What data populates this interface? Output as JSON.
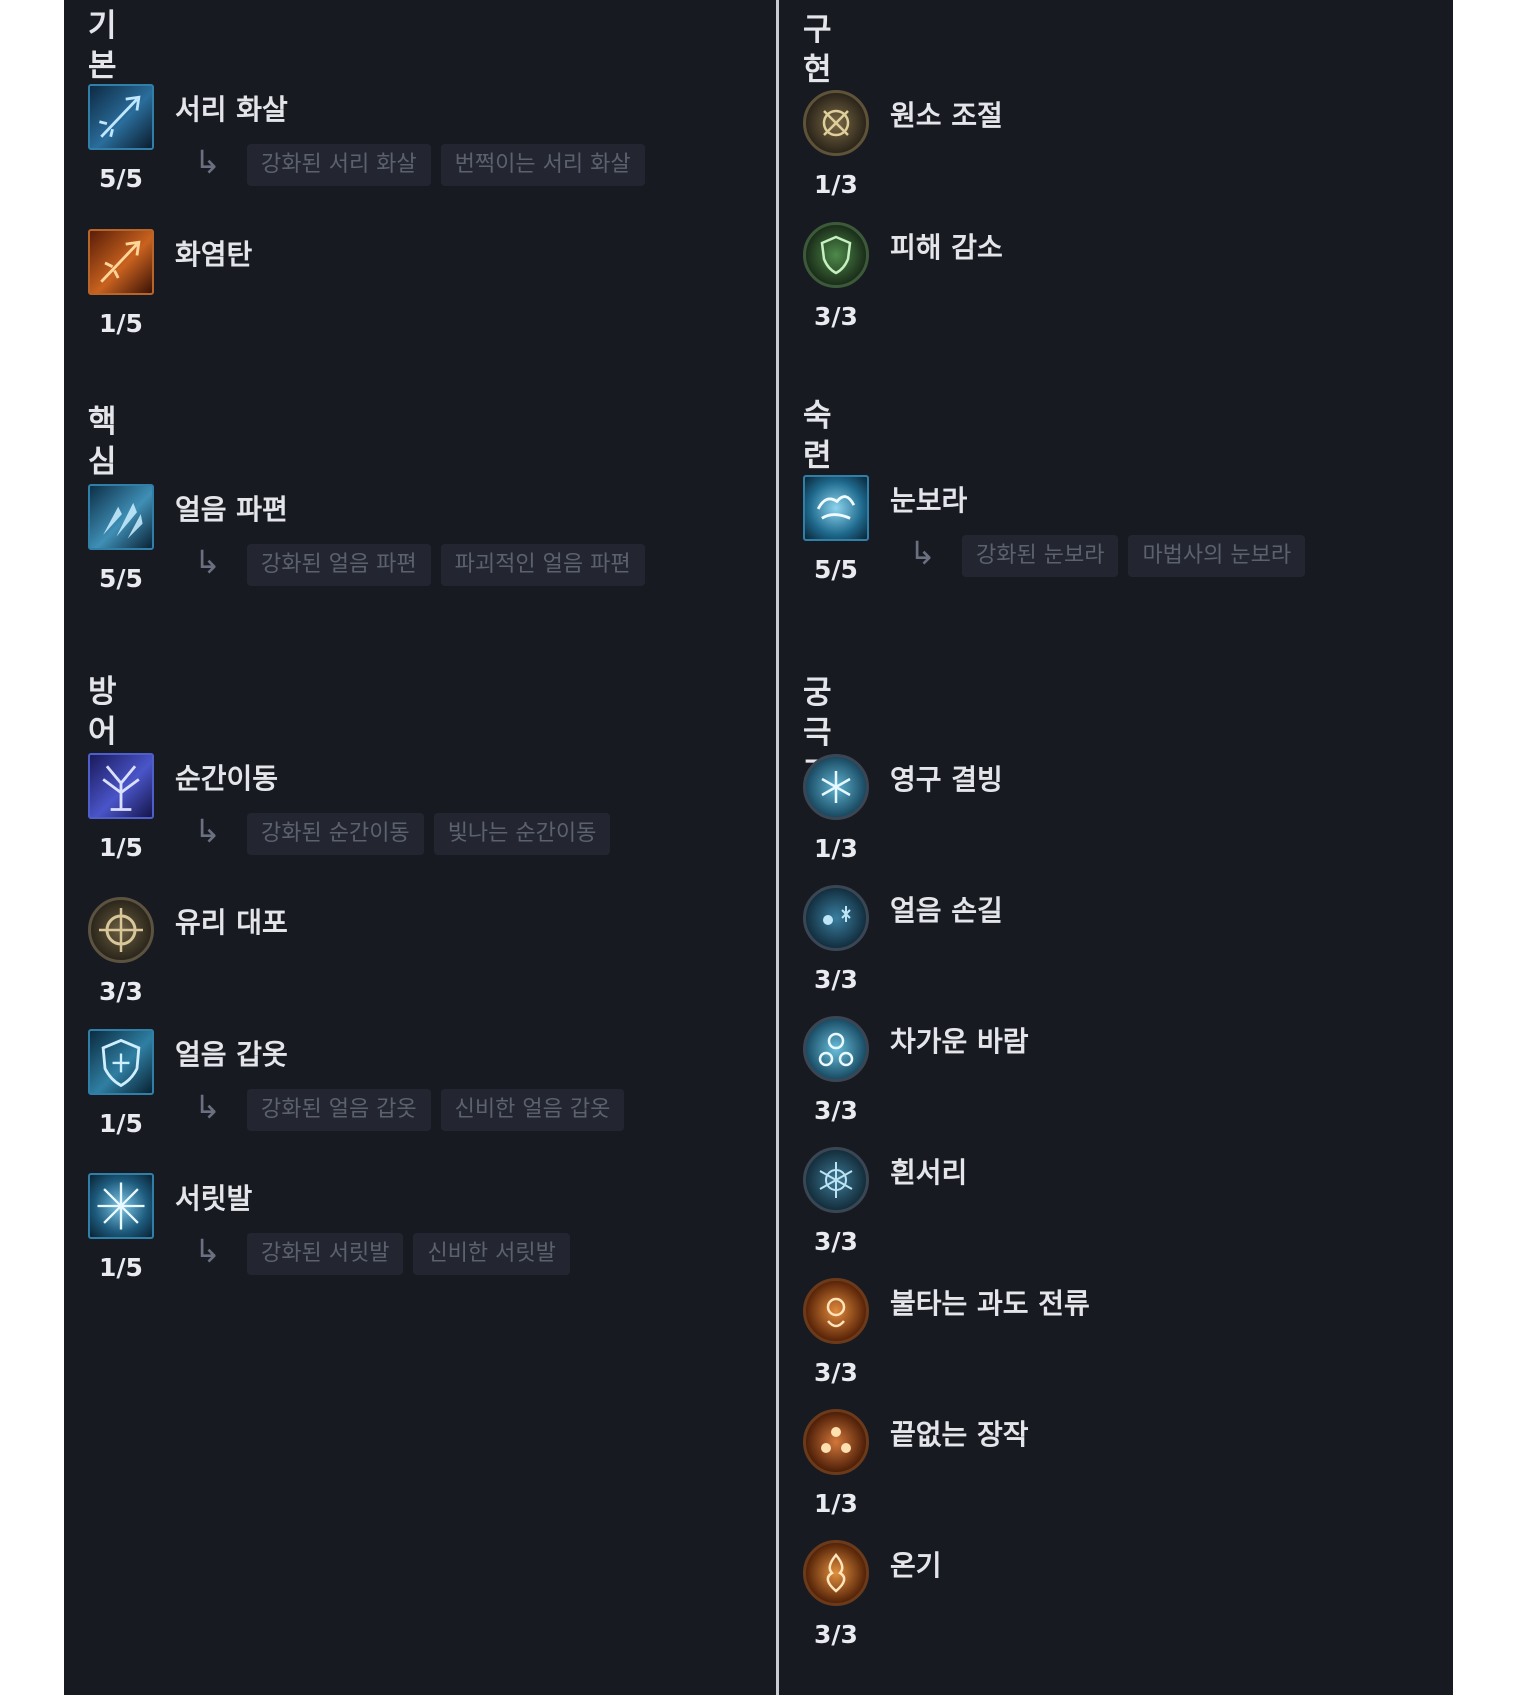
{
  "left": {
    "sections": [
      {
        "title": "기본",
        "skills": [
          {
            "name": "서리 화살",
            "rank": "5/5",
            "icon": "frost-arrow-icon",
            "mods": [
              "강화된 서리 화살",
              "번쩍이는 서리 화살"
            ]
          },
          {
            "name": "화염탄",
            "rank": "1/5",
            "icon": "fire-bolt-icon",
            "mods": []
          }
        ]
      },
      {
        "title": "핵심",
        "skills": [
          {
            "name": "얼음 파편",
            "rank": "5/5",
            "icon": "ice-shards-icon",
            "mods": [
              "강화된 얼음 파편",
              "파괴적인 얼음 파편"
            ]
          }
        ]
      },
      {
        "title": "방어",
        "skills": [
          {
            "name": "순간이동",
            "rank": "1/5",
            "icon": "teleport-icon",
            "mods": [
              "강화된 순간이동",
              "빛나는 순간이동"
            ]
          },
          {
            "name": "유리 대포",
            "rank": "3/3",
            "icon": "glass-cannon-icon",
            "mods": []
          },
          {
            "name": "얼음 갑옷",
            "rank": "1/5",
            "icon": "ice-armor-icon",
            "mods": [
              "강화된 얼음 갑옷",
              "신비한 얼음 갑옷"
            ]
          },
          {
            "name": "서릿발",
            "rank": "1/5",
            "icon": "frost-nova-icon",
            "mods": [
              "강화된 서릿발",
              "신비한 서릿발"
            ]
          }
        ]
      }
    ]
  },
  "right": {
    "sections": [
      {
        "title": "구현",
        "skills": [
          {
            "name": "원소 조절",
            "rank": "1/3",
            "icon": "elemental-attunement-icon",
            "mods": []
          },
          {
            "name": "피해 감소",
            "rank": "3/3",
            "icon": "damage-reduction-icon",
            "mods": []
          }
        ]
      },
      {
        "title": "숙련",
        "skills": [
          {
            "name": "눈보라",
            "rank": "5/5",
            "icon": "blizzard-icon",
            "mods": [
              "강화된 눈보라",
              "마법사의 눈보라"
            ]
          }
        ]
      },
      {
        "title": "궁극기",
        "skills": [
          {
            "name": "영구 결빙",
            "rank": "1/3",
            "icon": "permafrost-icon",
            "mods": []
          },
          {
            "name": "얼음 손길",
            "rank": "3/3",
            "icon": "icy-touch-icon",
            "mods": []
          },
          {
            "name": "차가운 바람",
            "rank": "3/3",
            "icon": "frigid-breeze-icon",
            "mods": []
          },
          {
            "name": "흰서리",
            "rank": "3/3",
            "icon": "hoarfrost-icon",
            "mods": []
          },
          {
            "name": "불타는 과도 전류",
            "rank": "3/3",
            "icon": "searing-heat-icon",
            "mods": []
          },
          {
            "name": "끝없는 장작",
            "rank": "1/3",
            "icon": "endless-pyre-icon",
            "mods": []
          },
          {
            "name": "온기",
            "rank": "3/3",
            "icon": "warmth-icon",
            "mods": []
          }
        ]
      }
    ]
  },
  "colors": {
    "panel": "#181a21",
    "text": "#e3e5ea",
    "mod_bg": "#232630",
    "mod_text": "#5c6170",
    "divider": "#c9ccd2"
  }
}
